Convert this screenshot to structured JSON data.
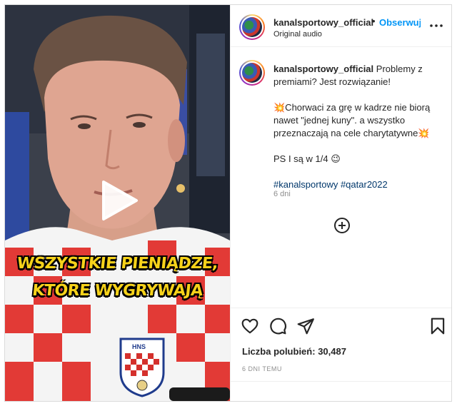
{
  "post": {
    "username": "kanalsportowy_official",
    "separator": "•",
    "follow_label": "Obserwuj",
    "audio_label": "Original audio"
  },
  "caption": {
    "username": "kanalsportowy_official",
    "text_intro": "Problemy z premiami? Jest rozwiązanie!",
    "text_body": "💥Chorwaci za grę w kadrze nie biorą nawet \"jednej kuny\". a wszystko przeznaczają na cele charytatywne💥",
    "text_ps": "PS I są w 1/4 😉",
    "hashtag_1": "#kanalsportowy",
    "hashtag_2": "#qatar2022",
    "relative_time": "6 dni"
  },
  "video": {
    "subtitle_line_1": "WSZYSTKIE PIENIĄDZE,",
    "subtitle_line_2": "KTÓRE WYGRYWAJĄ",
    "badge_text": "HNS"
  },
  "stats": {
    "likes_label": "Liczba polubień:",
    "likes_count": "30,487",
    "post_date": "6 DNI TEMU"
  },
  "icons": {
    "more": "more-horizontal-icon",
    "add": "plus-circle-icon",
    "like": "heart-icon",
    "comment": "comment-icon",
    "share": "send-icon",
    "save": "bookmark-icon",
    "play": "play-icon"
  }
}
